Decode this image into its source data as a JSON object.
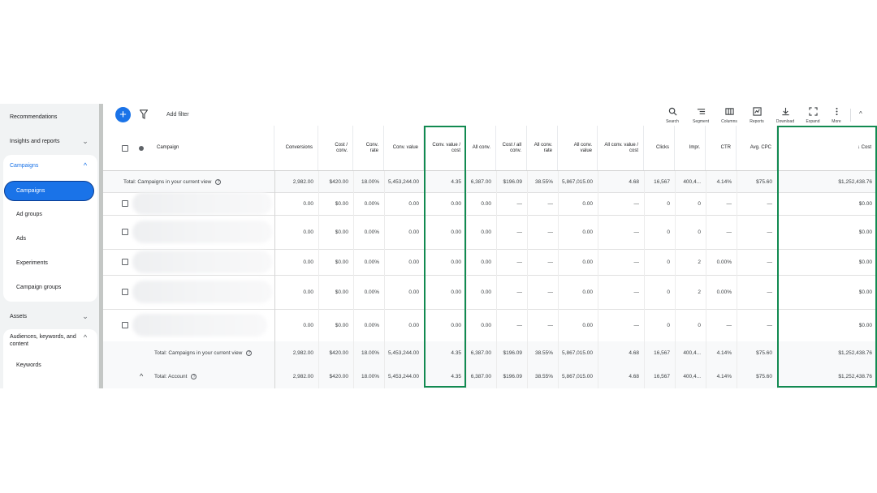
{
  "sidebar": {
    "items": [
      {
        "label": "Recommendations"
      },
      {
        "label": "Insights and reports"
      },
      {
        "label": "Campaigns"
      },
      {
        "label": "Assets"
      },
      {
        "label": "Audiences, keywords, and content"
      }
    ],
    "campaign_sub": [
      "Campaigns",
      "Ad groups",
      "Ads",
      "Experiments",
      "Campaign groups"
    ],
    "audience_sub": [
      "Keywords"
    ]
  },
  "toolbar": {
    "add_filter": "Add filter",
    "tools": [
      "Search",
      "Segment",
      "Columns",
      "Reports",
      "Download",
      "Expand",
      "More"
    ]
  },
  "table": {
    "headers": [
      "Campaign",
      "Conversions",
      "Cost / conv.",
      "Conv. rate",
      "Conv. value",
      "Conv. value / cost",
      "All conv.",
      "Cost / all conv.",
      "All conv. rate",
      "All conv. value",
      "All conv. value / cost",
      "Clicks",
      "Impr.",
      "CTR",
      "Avg. CPC",
      "↓ Cost"
    ],
    "top_total": {
      "label": "Total: Campaigns in your current view",
      "values": [
        "2,982.00",
        "$420.00",
        "18.00%",
        "5,453,244.00",
        "4.35",
        "6,387.00",
        "$196.09",
        "38.55%",
        "5,867,015.00",
        "4.68",
        "16,567",
        "400,4...",
        "4.14%",
        "$75.60",
        "$1,252,438.76"
      ]
    },
    "rows": [
      {
        "values": [
          "0.00",
          "$0.00",
          "0.00%",
          "0.00",
          "0.00",
          "0.00",
          "—",
          "—",
          "0.00",
          "—",
          "0",
          "0",
          "—",
          "—",
          "$0.00"
        ]
      },
      {
        "values": [
          "0.00",
          "$0.00",
          "0.00%",
          "0.00",
          "0.00",
          "0.00",
          "—",
          "—",
          "0.00",
          "—",
          "0",
          "0",
          "—",
          "—",
          "$0.00"
        ]
      },
      {
        "values": [
          "0.00",
          "$0.00",
          "0.00%",
          "0.00",
          "0.00",
          "0.00",
          "—",
          "—",
          "0.00",
          "—",
          "0",
          "2",
          "0.00%",
          "—",
          "$0.00"
        ]
      },
      {
        "values": [
          "0.00",
          "$0.00",
          "0.00%",
          "0.00",
          "0.00",
          "0.00",
          "—",
          "—",
          "0.00",
          "—",
          "0",
          "2",
          "0.00%",
          "—",
          "$0.00"
        ]
      },
      {
        "values": [
          "0.00",
          "$0.00",
          "0.00%",
          "0.00",
          "0.00",
          "0.00",
          "—",
          "—",
          "0.00",
          "—",
          "0",
          "0",
          "—",
          "—",
          "$0.00"
        ]
      }
    ],
    "bottom_total": {
      "label": "Total: Campaigns in your current view",
      "values": [
        "2,982.00",
        "$420.00",
        "18.00%",
        "5,453,244.00",
        "4.35",
        "6,387.00",
        "$196.09",
        "38.55%",
        "5,867,015.00",
        "4.68",
        "16,567",
        "400,4...",
        "4.14%",
        "$75.60",
        "$1,252,438.76"
      ]
    },
    "account_total": {
      "label": "Total: Account",
      "values": [
        "2,982.00",
        "$420.00",
        "18.00%",
        "5,453,244.00",
        "4.35",
        "6,387.00",
        "$196.09",
        "38.55%",
        "5,867,015.00",
        "4.68",
        "16,567",
        "400,4...",
        "4.14%",
        "$75.60",
        "$1,252,438.76"
      ]
    }
  },
  "colors": {
    "accent": "#1a73e8",
    "highlight": "#128a51"
  }
}
